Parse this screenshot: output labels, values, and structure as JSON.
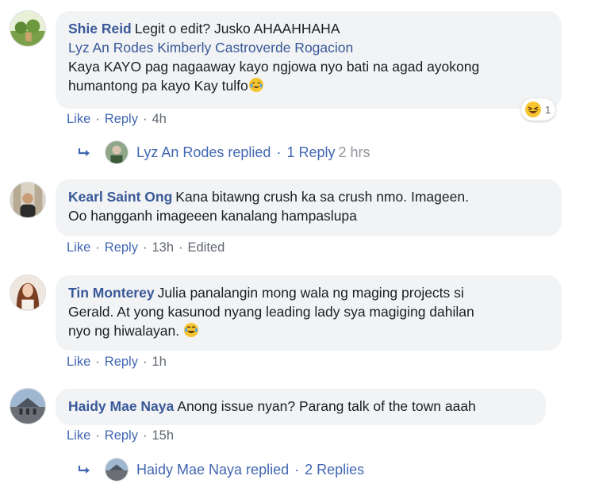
{
  "comments": [
    {
      "author": "Shie Reid",
      "text_line1": "Legit o edit? Jusko AHAAHHAHA",
      "mentions": "Lyz An Rodes Kimberly Castroverde Rogacion",
      "text_line2": "Kaya KAYO pag nagaaway kayo ngjowa nyo bati na agad ayokong",
      "text_line3": "humantong pa kayo Kay tulfo",
      "like": "Like",
      "reply": "Reply",
      "time": "4h",
      "reaction_icon": "laughing-emoji-icon",
      "reaction_count": "1",
      "replies": {
        "replier": "Lyz An Rodes replied",
        "count": "1 Reply",
        "time": "2 hrs"
      }
    },
    {
      "author": "Kearl Saint Ong",
      "text_line1": "Kana bitawng crush ka sa crush nmo. Imageen.",
      "text_line2": "Oo hangganh imageeen kanalang hampaslupa",
      "like": "Like",
      "reply": "Reply",
      "time": "13h",
      "edited": "Edited"
    },
    {
      "author": "Tin Monterey",
      "text_line1": "Julia panalangin mong wala ng maging projects si",
      "text_line2": "Gerald. At yong kasunod nyang leading lady sya magiging dahilan",
      "text_line3": "nyo ng hiwalayan.",
      "like": "Like",
      "reply": "Reply",
      "time": "1h"
    },
    {
      "author": "Haidy Mae Naya",
      "text_line1": "Anong issue nyan? Parang talk of the town aaah",
      "like": "Like",
      "reply": "Reply",
      "time": "15h",
      "replies": {
        "replier": "Haidy Mae Naya replied",
        "count": "2 Replies"
      }
    }
  ],
  "colors": {
    "link": "#385898",
    "action": "#4267b2",
    "muted": "#606770",
    "bubble": "#f2f3f5"
  }
}
